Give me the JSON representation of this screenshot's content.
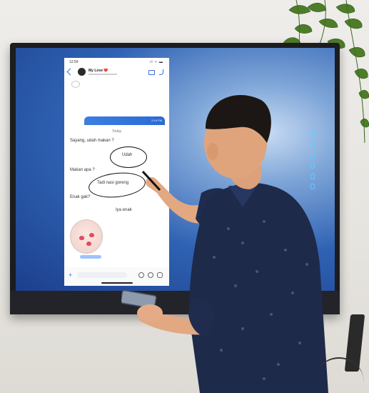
{
  "status": {
    "time": "12:59",
    "signal": "ıl ≈ ▬"
  },
  "chat": {
    "contact_name": "My Love ❤️",
    "day_label": "Today",
    "bar_time": "2:16 PM",
    "messages": [
      {
        "text": "Sayang, udah makan ?",
        "side": "in"
      },
      {
        "text": "Udah",
        "side": "out",
        "circled": true
      },
      {
        "text": "Makan apa ?",
        "side": "in"
      },
      {
        "text": "Tadi nasi goreng",
        "side": "out",
        "circled": true
      },
      {
        "text": "Enak gak?",
        "side": "in"
      },
      {
        "text": "Iya enak",
        "side": "out"
      }
    ]
  },
  "icons": [
    "back-icon",
    "video-icon",
    "call-icon",
    "plus-icon",
    "camera-icon",
    "mic-icon"
  ],
  "colors": {
    "screen_blue": "#2f62b3",
    "accent": "#3a6fd8",
    "shirt": "#1e2a4a",
    "bezel": "#1b1d20"
  }
}
